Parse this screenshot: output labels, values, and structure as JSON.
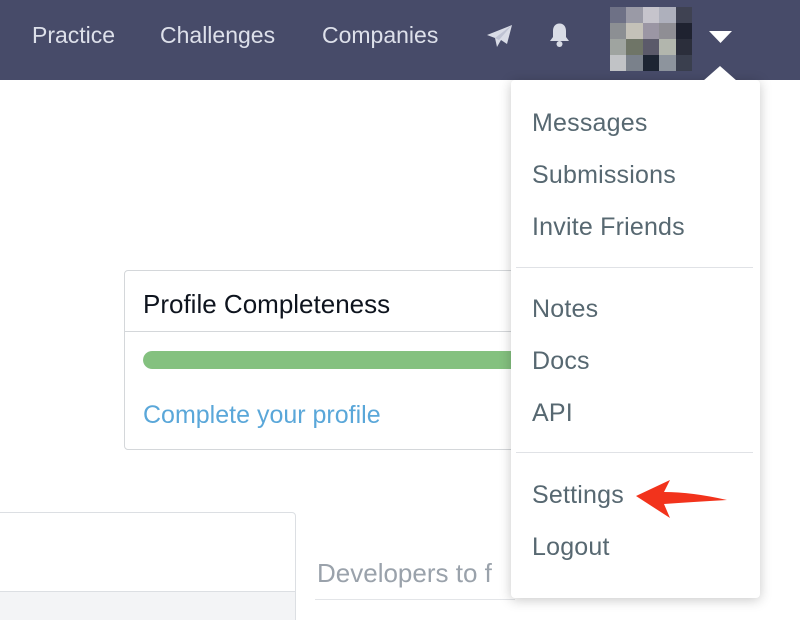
{
  "nav": {
    "links": [
      "Practice",
      "Challenges",
      "Companies"
    ],
    "icons": [
      "send-icon",
      "bell-icon",
      "caret-down-icon"
    ],
    "background": "#474b69"
  },
  "menu": {
    "items": [
      "Messages",
      "Submissions",
      "Invite Friends",
      "Notes",
      "Docs",
      "API",
      "Settings",
      "Logout"
    ],
    "highlighted": "Settings",
    "annotation_color": "#f2331c"
  },
  "profile": {
    "title": "Profile Completeness",
    "link": "Complete your profile",
    "progress_color": "#84c17f",
    "link_color": "#5aa7d9"
  },
  "lower": {
    "right_title": "Developers to f"
  }
}
